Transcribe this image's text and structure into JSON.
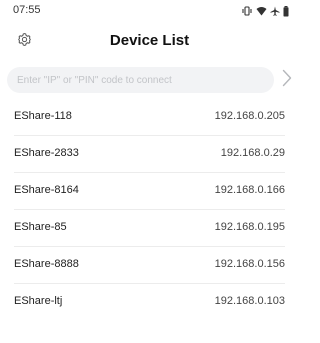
{
  "status_bar": {
    "time": "07:55",
    "icons": [
      "vibrate-icon",
      "wifi-icon",
      "airplane-icon",
      "battery-icon"
    ]
  },
  "header": {
    "title": "Device List",
    "settings_icon": "gear-icon"
  },
  "search": {
    "placeholder": "Enter \"IP\" or \"PIN\" code to connect",
    "value": "",
    "go_icon": "chevron-right-icon"
  },
  "devices": [
    {
      "name": "EShare-118",
      "ip": "192.168.0.205"
    },
    {
      "name": "EShare-2833",
      "ip": "192.168.0.29"
    },
    {
      "name": "EShare-8164",
      "ip": "192.168.0.166"
    },
    {
      "name": "EShare-85",
      "ip": "192.168.0.195"
    },
    {
      "name": "EShare-8888",
      "ip": "192.168.0.156"
    },
    {
      "name": "EShare-ltj",
      "ip": "192.168.0.103"
    }
  ],
  "colors": {
    "background": "#ffffff",
    "input_background": "#f2f3f5",
    "divider": "#ececec",
    "text": "#222222"
  }
}
